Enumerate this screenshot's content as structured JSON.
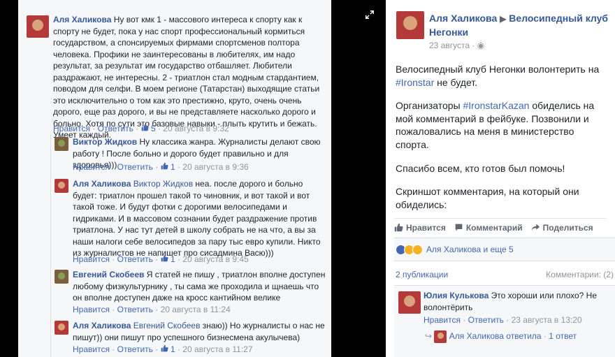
{
  "left_comments": [
    {
      "author": "Аля Халикова",
      "text": "Ну вот кмк 1 - массового интереса к спорту как к спорту не будет, пока у нас спорт профессиональный кормиться государством, а спонсируемых фирмами спортсменов полтора человека. Профики не заинтересованы в любителях, им надо результат, за результат им государство отбашляет. Любители раздражают, не интересны. 2 - триатлон стал модным стардантием, поводом для селфи. В моем регионе (Татарстан) выходящие статьи это исключительно о том как это престижно, круто, очень очень дорого, еще раз дорого, и вы не представляете насколько дорого и больно. Хотя по сути это базовые навыки - плыть крутить и бежать. Умеет каждый.",
      "like": "Нравится",
      "reply": "Ответить",
      "likes": "5",
      "time": "20 августа в 9:32"
    },
    {
      "author": "Виктор Жидков",
      "text": "Ну классика жанра. Журналисты делают свою работу ! После больно и дорого будет правильно и для здоровья)))",
      "like": "Нравится",
      "reply": "Ответить",
      "likes": "1",
      "time": "20 августа в 9:36"
    },
    {
      "author": "Аля Халикова",
      "mention": "Виктор Жидков",
      "text": "неа. после дорого и больно будет: триатлон прошел такой то чиновник, и вот такой и вот такой тоже. И будут фотки с дорогими велосипедами и гидриками. И в массовом сознании будет раздражение против триатлона. У нас тут детей в школу собрать не на что, а вы за наши налоги себе велосипедов за пару тыс евро купили. Никто из журналистов не напишет про сисадмина Васю)))",
      "like": "Нравится",
      "reply": "Ответить",
      "likes": "1",
      "time": "20 августа в 9:45"
    },
    {
      "author": "Евгений Скобеев",
      "text": "Я статей не пишу , триатлон вполне доступен любому физкультурнику , ты сама же проходила и щнаешь что он вполне доступен даже на кросс кантийном велике",
      "like": "Нравится",
      "reply": "Ответить",
      "time": "20 августа в 11:24"
    },
    {
      "author": "Аля Халикова",
      "mention": "Евгений Скобеев",
      "text": "знаю)) Но журналисты о нас не пишут)) они пишут про успешного бизнесмена акулычева)",
      "like": "Нравится",
      "reply": "Ответить",
      "likes": "1",
      "time": "20 августа в 11:27"
    }
  ],
  "post": {
    "author": "Аля Халикова",
    "group": "Велосипедный клуб Негонки",
    "date": "23 августа",
    "paragraphs": [
      {
        "before": "Велосипедный клуб Негонки волонтерить на ",
        "tag": "#Ironstar",
        "after": " не будет."
      },
      {
        "before": "Организаторы ",
        "tag": "#IronstarKazan",
        "after": " обиделись на мой комментарий в фейбуке. Позвонили и пожаловались на меня в министерство спорта."
      },
      {
        "before": "Спасибо всем, кто готов был помочь!",
        "tag": "",
        "after": ""
      },
      {
        "before": "Скриншот комментария, на который они обиделись:",
        "tag": "",
        "after": ""
      }
    ],
    "actions": {
      "like": "Нравится",
      "comment": "Комментарий",
      "share": "Поделиться"
    },
    "reactions_text": "Аля Халикова и еще 5",
    "publications": "2 публикации",
    "comments_count": "Комментарии: (2)"
  },
  "post_comment": {
    "author": "Юлия Кулькова",
    "text": "Это хороши или плохо? Не волонтёрить",
    "like": "Нравится",
    "reply": "Ответить",
    "time": "23 августа в 13:20",
    "reply_summary_author": "Аля Халикова ответила",
    "reply_summary_count": "1 ответ"
  },
  "colors": {
    "link": "#365899",
    "accent": "#4267b2",
    "muted": "#90949c",
    "background": "#000000"
  }
}
